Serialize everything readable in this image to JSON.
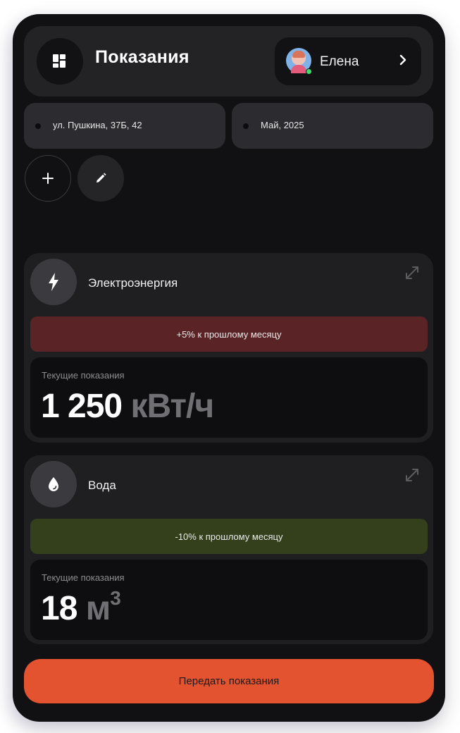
{
  "header": {
    "title": "Показания",
    "menu_icon": "grid-icon",
    "user": {
      "name": "Елена",
      "status_color": "#3ddc6b"
    }
  },
  "filters": {
    "address": "ул. Пушкина, 37Б, 42",
    "period": "Май, 2025"
  },
  "actions": {
    "add_icon": "plus-icon",
    "edit_icon": "pencil-icon"
  },
  "meters": [
    {
      "title": "Электроэнергия",
      "icon": "lightning-icon",
      "trend": "+5% к прошлому месяцу",
      "trend_color": "#5a2426",
      "reading_label": "Текущие показания",
      "value": "1 250",
      "unit": "кВт/ч"
    },
    {
      "title": "Вода",
      "icon": "water-drop-icon",
      "trend": "-10% к прошлому месяцу",
      "trend_color": "#33401b",
      "reading_label": "Текущие показания",
      "value": "18",
      "unit": "м",
      "unit_sup": "3"
    }
  ],
  "submit_label": "Передать показания",
  "colors": {
    "accent": "#e4532f",
    "background": "#111113"
  }
}
